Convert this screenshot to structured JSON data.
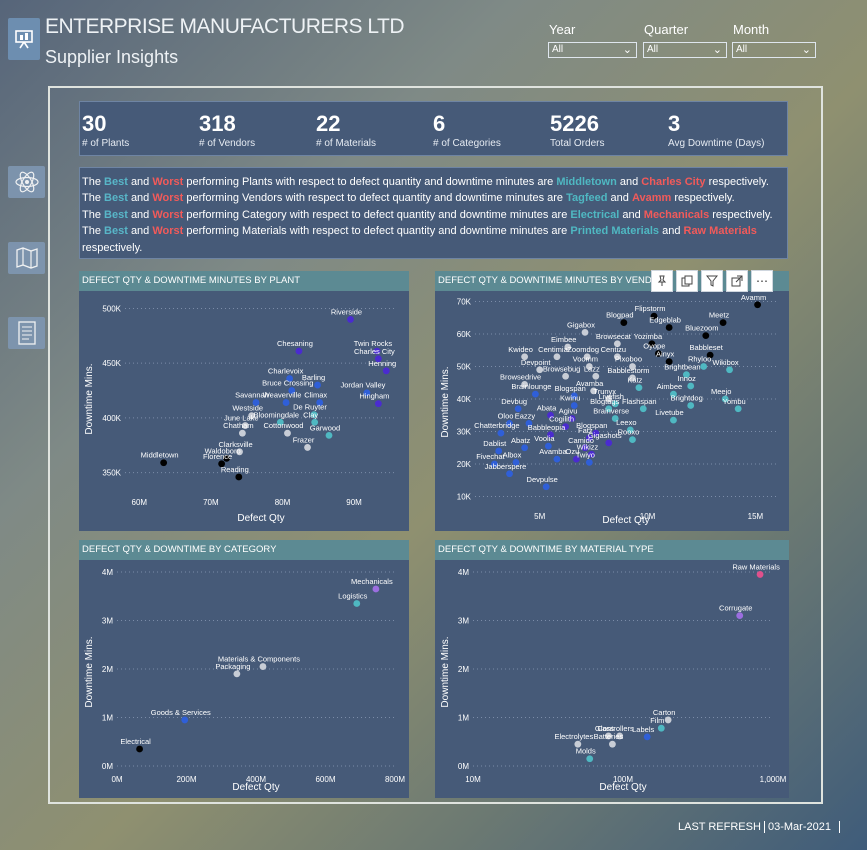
{
  "header": {
    "title": "ENTERPRISE MANUFACTURERS LTD",
    "subtitle": "Supplier Insights"
  },
  "filters": [
    {
      "label": "Year",
      "value": "All"
    },
    {
      "label": "Quarter",
      "value": "All"
    },
    {
      "label": "Month",
      "value": "All"
    }
  ],
  "kpis": [
    {
      "value": "30",
      "label": "# of Plants"
    },
    {
      "value": "318",
      "label": "# of Vendors"
    },
    {
      "value": "22",
      "label": "# of Materials"
    },
    {
      "value": "6",
      "label": "# of Categories"
    },
    {
      "value": "5226",
      "label": "Total Orders"
    },
    {
      "value": "3",
      "label": "Avg Downtime (Days)"
    }
  ],
  "insights": {
    "the": "The",
    "best": "Best",
    "and": "and",
    "worst": "Worst",
    "are": "are",
    "respectively": "respectively.",
    "lines": [
      {
        "pre": "performing Plants with respect to defect quantity and downtime minutes are",
        "best": "Middletown",
        "worst": "Charles City"
      },
      {
        "pre": "performing Vendors with respect to defect quantity and downtime minutes are",
        "best": "Tagfeed",
        "worst": "Avamm"
      },
      {
        "pre": "performing Category with respect to defect quantity and downtime minutes are",
        "best": "Electrical",
        "worst": "Mechanicals"
      },
      {
        "pre": "performing Materials with respect to defect quantity and downtime minutes are",
        "best": "Printed Materials",
        "worst": "Raw Materials"
      }
    ]
  },
  "footer": {
    "last_refresh_label": "LAST REFRESH",
    "date": "03-Mar-2021"
  },
  "colors": {
    "panel": "#465a78",
    "header_bar": "#5c8a93",
    "best": "#58b6c8",
    "worst": "#f25a5a"
  },
  "icons": {
    "logo": "presentation-icon",
    "side1": "atom-icon",
    "side2": "map-icon",
    "side3": "document-icon"
  },
  "chart_data": [
    {
      "type": "scatter",
      "title": "DEFECT QTY & DOWNTIME MINUTES BY PLANT",
      "xlabel": "Defect Qty",
      "ylabel": "Downtime Mins.",
      "xlim": [
        58,
        96
      ],
      "ylim": [
        335,
        505
      ],
      "xticks": [
        {
          "v": 60,
          "t": "60M"
        },
        {
          "v": 70,
          "t": "70M"
        },
        {
          "v": 80,
          "t": "80M"
        },
        {
          "v": 90,
          "t": "90M"
        }
      ],
      "yticks": [
        {
          "v": 350,
          "t": "350K"
        },
        {
          "v": 400,
          "t": "400K"
        },
        {
          "v": 450,
          "t": "450K"
        },
        {
          "v": 500,
          "t": "500K"
        }
      ],
      "points": [
        {
          "label": "Riverside",
          "x": 89.5,
          "y": 490,
          "c": "#4a2bd0"
        },
        {
          "label": "Twin Rocks",
          "x": 93.2,
          "y": 461,
          "c": "#4a2bd0"
        },
        {
          "label": "Chesaning",
          "x": 82.3,
          "y": 461,
          "c": "#4a2bd0"
        },
        {
          "label": "Charles City",
          "x": 93.4,
          "y": 454,
          "c": "#4a2bd0"
        },
        {
          "label": "Henning",
          "x": 94.5,
          "y": 443,
          "c": "#4a2bd0"
        },
        {
          "label": "Charlevoix",
          "x": 81,
          "y": 436,
          "c": "#2f5fd8"
        },
        {
          "label": "Barling",
          "x": 84.9,
          "y": 430,
          "c": "#2f5fd8"
        },
        {
          "label": "Bruce Crossing",
          "x": 81.3,
          "y": 425,
          "c": "#2f5fd8"
        },
        {
          "label": "Jordan Valley",
          "x": 91.8,
          "y": 423,
          "c": "#2f5fd8"
        },
        {
          "label": "Savannah",
          "x": 76.3,
          "y": 414,
          "c": "#2f5fd8"
        },
        {
          "label": "Weaverville",
          "x": 80.5,
          "y": 414,
          "c": "#2f5fd8"
        },
        {
          "label": "Climax",
          "x": 85.2,
          "y": 414,
          "c": "#2f5fd8"
        },
        {
          "label": "Hingham",
          "x": 93.4,
          "y": 413,
          "c": "#4a2bd0"
        },
        {
          "label": "De Ruyter",
          "x": 84.4,
          "y": 403,
          "c": "#4fb8c2"
        },
        {
          "label": "Westside",
          "x": 75.7,
          "y": 402,
          "c": "#c8cdd6"
        },
        {
          "label": "Bloomingdale",
          "x": 79.7,
          "y": 396,
          "c": "#4fb8c2"
        },
        {
          "label": "Clay",
          "x": 84.5,
          "y": 396,
          "c": "#4fb8c2"
        },
        {
          "label": "June Lake",
          "x": 74.8,
          "y": 393,
          "c": "#c8cdd6"
        },
        {
          "label": "Chatham",
          "x": 74.4,
          "y": 386,
          "c": "#c8cdd6"
        },
        {
          "label": "Cottonwood",
          "x": 80.7,
          "y": 386,
          "c": "#c8cdd6"
        },
        {
          "label": "Garwood",
          "x": 86.5,
          "y": 384,
          "c": "#4fb8c2"
        },
        {
          "label": "Frazer",
          "x": 83.5,
          "y": 373,
          "c": "#c8cdd6"
        },
        {
          "label": "Clarksville",
          "x": 74,
          "y": 369,
          "c": "#c8cdd6"
        },
        {
          "label": "Waldoboro",
          "x": 72.2,
          "y": 363,
          "c": "#000000"
        },
        {
          "label": "Middletown",
          "x": 63.4,
          "y": 359,
          "c": "#000000"
        },
        {
          "label": "Florence",
          "x": 71.5,
          "y": 358,
          "c": "#000000"
        },
        {
          "label": "Reading",
          "x": 73.9,
          "y": 346,
          "c": "#000000"
        }
      ]
    },
    {
      "type": "scatter",
      "title": "DEFECT QTY & DOWNTIME MINUTES BY VENDOR",
      "xlabel": "Defect Qty",
      "ylabel": "Downtime Mins.",
      "xlim": [
        2,
        16
      ],
      "ylim": [
        8,
        72
      ],
      "xticks": [
        {
          "v": 5,
          "t": "5M"
        },
        {
          "v": 10,
          "t": "10M"
        },
        {
          "v": 15,
          "t": "15M"
        }
      ],
      "yticks": [
        {
          "v": 10,
          "t": "10K"
        },
        {
          "v": 20,
          "t": "20K"
        },
        {
          "v": 30,
          "t": "30K"
        },
        {
          "v": 40,
          "t": "40K"
        },
        {
          "v": 50,
          "t": "50K"
        },
        {
          "v": 60,
          "t": "60K"
        },
        {
          "v": 70,
          "t": "70K"
        }
      ],
      "points": [
        {
          "label": "Avamm",
          "x": 15.1,
          "y": 69,
          "c": "#000000"
        },
        {
          "label": "Flipstorm",
          "x": 10.3,
          "y": 65.5,
          "c": "#000000"
        },
        {
          "label": "Blogpad",
          "x": 8.9,
          "y": 63.5,
          "c": "#000000"
        },
        {
          "label": "Meetz",
          "x": 13.5,
          "y": 63.5,
          "c": "#000000"
        },
        {
          "label": "Gigabox",
          "x": 7.1,
          "y": 60.5,
          "c": "#c8cdd6"
        },
        {
          "label": "Edgeblab",
          "x": 11,
          "y": 62,
          "c": "#000000"
        },
        {
          "label": "Bluezoom",
          "x": 12.7,
          "y": 59.5,
          "c": "#000000"
        },
        {
          "label": "Browsecat",
          "x": 8.6,
          "y": 57,
          "c": "#c8cdd6"
        },
        {
          "label": "Eimbee",
          "x": 6.3,
          "y": 56,
          "c": "#c8cdd6"
        },
        {
          "label": "Yozimba",
          "x": 10.2,
          "y": 57,
          "c": "#000000"
        },
        {
          "label": "Kwideo",
          "x": 4.3,
          "y": 53,
          "c": "#c8cdd6"
        },
        {
          "label": "Centimia",
          "x": 5.8,
          "y": 53,
          "c": "#c8cdd6"
        },
        {
          "label": "Zoomdog",
          "x": 7.2,
          "y": 53,
          "c": "#c8cdd6"
        },
        {
          "label": "Centizu",
          "x": 8.6,
          "y": 53,
          "c": "#c8cdd6"
        },
        {
          "label": "Oyope",
          "x": 10.5,
          "y": 54,
          "c": "#000000"
        },
        {
          "label": "Babbleset",
          "x": 12.9,
          "y": 53.5,
          "c": "#000000"
        },
        {
          "label": "Ainyx",
          "x": 11,
          "y": 51.5,
          "c": "#000000"
        },
        {
          "label": "Devpoint",
          "x": 5,
          "y": 49,
          "c": "#c8cdd6"
        },
        {
          "label": "Voomm",
          "x": 7.3,
          "y": 50,
          "c": "#c8cdd6"
        },
        {
          "label": "Pixoboo",
          "x": 9.3,
          "y": 50,
          "c": "#c8cdd6"
        },
        {
          "label": "Rhyloo",
          "x": 12.6,
          "y": 50,
          "c": "#4fb8c2"
        },
        {
          "label": "Brightbean",
          "x": 11.8,
          "y": 47.5,
          "c": "#4fb8c2"
        },
        {
          "label": "Wikibox",
          "x": 13.8,
          "y": 49,
          "c": "#4fb8c2"
        },
        {
          "label": "Browsebug",
          "x": 6.2,
          "y": 47,
          "c": "#c8cdd6"
        },
        {
          "label": "Lazz",
          "x": 7.6,
          "y": 47,
          "c": "#c8cdd6"
        },
        {
          "label": "Babblestorm",
          "x": 9.3,
          "y": 46.5,
          "c": "#c8cdd6"
        },
        {
          "label": "Browsedrive",
          "x": 4.3,
          "y": 44.5,
          "c": "#c8cdd6"
        },
        {
          "label": "Avamba",
          "x": 7.5,
          "y": 42.5,
          "c": "#c8cdd6"
        },
        {
          "label": "Katz",
          "x": 9.6,
          "y": 43.5,
          "c": "#4fb8c2"
        },
        {
          "label": "Innoz",
          "x": 12,
          "y": 44,
          "c": "#4fb8c2"
        },
        {
          "label": "Brainlounge",
          "x": 4.8,
          "y": 41.5,
          "c": "#2f5fd8"
        },
        {
          "label": "Blogspan",
          "x": 6.6,
          "y": 41,
          "c": "#2f5fd8"
        },
        {
          "label": "Trunyx",
          "x": 8.2,
          "y": 40,
          "c": "#c8cdd6"
        },
        {
          "label": "Aimbee",
          "x": 11.2,
          "y": 41.5,
          "c": "#4fb8c2"
        },
        {
          "label": "Meejo",
          "x": 13.6,
          "y": 40,
          "c": "#4fb8c2"
        },
        {
          "label": "Livefish",
          "x": 8.5,
          "y": 38.5,
          "c": "#4fb8c2"
        },
        {
          "label": "Devbug",
          "x": 4,
          "y": 37,
          "c": "#2f5fd8"
        },
        {
          "label": "Kwinu",
          "x": 6.6,
          "y": 38,
          "c": "#2f5fd8"
        },
        {
          "label": "Blogtags",
          "x": 8.2,
          "y": 37,
          "c": "#4fb8c2"
        },
        {
          "label": "Flashspan",
          "x": 9.8,
          "y": 37,
          "c": "#4fb8c2"
        },
        {
          "label": "Brightdog",
          "x": 12,
          "y": 38,
          "c": "#4fb8c2"
        },
        {
          "label": "Yombu",
          "x": 14.2,
          "y": 37,
          "c": "#4fb8c2"
        },
        {
          "label": "Abata",
          "x": 5.5,
          "y": 35,
          "c": "#4a2bd0"
        },
        {
          "label": "Agivu",
          "x": 6.5,
          "y": 34,
          "c": "#4a2bd0"
        },
        {
          "label": "Brainverse",
          "x": 8.5,
          "y": 34,
          "c": "#4fb8c2"
        },
        {
          "label": "Livetube",
          "x": 11.2,
          "y": 33.5,
          "c": "#4fb8c2"
        },
        {
          "label": "Oloo",
          "x": 3.6,
          "y": 32.5,
          "c": "#2f5fd8"
        },
        {
          "label": "Eazzy",
          "x": 4.5,
          "y": 32.5,
          "c": "#2f5fd8"
        },
        {
          "label": "Cogilith",
          "x": 6.2,
          "y": 31.5,
          "c": "#4a2bd0"
        },
        {
          "label": "Leexo",
          "x": 9.2,
          "y": 30.5,
          "c": "#4fb8c2"
        },
        {
          "label": "Chatterbridge",
          "x": 3.2,
          "y": 29.5,
          "c": "#2f5fd8"
        },
        {
          "label": "Babbleopia",
          "x": 5.5,
          "y": 29,
          "c": "#4a2bd0"
        },
        {
          "label": "Blogspan",
          "x": 7.6,
          "y": 29.5,
          "c": "#4a2bd0"
        },
        {
          "label": "Fatz",
          "x": 7.3,
          "y": 28,
          "c": "#4a2bd0"
        },
        {
          "label": "Rooxo",
          "x": 9.3,
          "y": 27.5,
          "c": "#4fb8c2"
        },
        {
          "label": "Gigashots",
          "x": 8.2,
          "y": 26.5,
          "c": "#4a2bd0"
        },
        {
          "label": "Abatz",
          "x": 4.3,
          "y": 25,
          "c": "#2f5fd8"
        },
        {
          "label": "Voolia",
          "x": 5.4,
          "y": 25.5,
          "c": "#2f5fd8"
        },
        {
          "label": "Camido",
          "x": 7.1,
          "y": 25,
          "c": "#4a2bd0"
        },
        {
          "label": "Dablist",
          "x": 3.1,
          "y": 24,
          "c": "#2f5fd8"
        },
        {
          "label": "Wikizz",
          "x": 7.4,
          "y": 23,
          "c": "#4a2bd0"
        },
        {
          "label": "Albox",
          "x": 3.9,
          "y": 20.5,
          "c": "#2f5fd8"
        },
        {
          "label": "Avamba",
          "x": 5.8,
          "y": 21.5,
          "c": "#2f5fd8"
        },
        {
          "label": "Ozu",
          "x": 6.7,
          "y": 21.5,
          "c": "#4a2bd0"
        },
        {
          "label": "Twiyo",
          "x": 7.3,
          "y": 20.5,
          "c": "#2f5fd8"
        },
        {
          "label": "Fivechat",
          "x": 2.9,
          "y": 20,
          "c": "#2f5fd8"
        },
        {
          "label": "Jabberspere",
          "x": 3.6,
          "y": 17,
          "c": "#2f5fd8"
        },
        {
          "label": "Devpulse",
          "x": 5.3,
          "y": 13,
          "c": "#2f5fd8"
        }
      ]
    },
    {
      "type": "scatter",
      "title": "DEFECT QTY & DOWNTIME BY CATEGORY",
      "xlabel": "Defect Qty",
      "ylabel": "Downtime Mins.",
      "xlim": [
        0,
        800
      ],
      "ylim": [
        0,
        4
      ],
      "xticks": [
        {
          "v": 0,
          "t": "0M"
        },
        {
          "v": 200,
          "t": "200M"
        },
        {
          "v": 400,
          "t": "400M"
        },
        {
          "v": 600,
          "t": "600M"
        },
        {
          "v": 800,
          "t": "800M"
        }
      ],
      "yticks": [
        {
          "v": 0,
          "t": "0M"
        },
        {
          "v": 1,
          "t": "1M"
        },
        {
          "v": 2,
          "t": "2M"
        },
        {
          "v": 3,
          "t": "3M"
        },
        {
          "v": 4,
          "t": "4M"
        }
      ],
      "points": [
        {
          "label": "Mechanicals",
          "x": 745,
          "y": 3.65,
          "c": "#9b6ee0"
        },
        {
          "label": "Logistics",
          "x": 690,
          "y": 3.35,
          "c": "#4fb8c2"
        },
        {
          "label": "Materials & Components",
          "x": 420,
          "y": 2.05,
          "c": "#c8cdd6"
        },
        {
          "label": "Packaging",
          "x": 345,
          "y": 1.9,
          "c": "#c8cdd6"
        },
        {
          "label": "Goods & Services",
          "x": 195,
          "y": 0.95,
          "c": "#2f5fd8"
        },
        {
          "label": "Electrical",
          "x": 65,
          "y": 0.35,
          "c": "#000000"
        }
      ]
    },
    {
      "type": "scatter",
      "title": "DEFECT QTY & DOWNTIME BY MATERIAL TYPE",
      "xlabel": "Defect Qty",
      "ylabel": "Downtime Mins.",
      "xscale": "log",
      "xlim": [
        10,
        1000
      ],
      "ylim": [
        0,
        4
      ],
      "xticks": [
        {
          "v": 10,
          "t": "10M"
        },
        {
          "v": 100,
          "t": "100M"
        },
        {
          "v": 1000,
          "t": "1,000M"
        }
      ],
      "yticks": [
        {
          "v": 0,
          "t": "0M"
        },
        {
          "v": 1,
          "t": "1M"
        },
        {
          "v": 2,
          "t": "2M"
        },
        {
          "v": 3,
          "t": "3M"
        },
        {
          "v": 4,
          "t": "4M"
        }
      ],
      "points": [
        {
          "label": "Raw Materials",
          "x": 820,
          "y": 3.95,
          "c": "#e0508c"
        },
        {
          "label": "Corrugate",
          "x": 600,
          "y": 3.1,
          "c": "#9b6ee0"
        },
        {
          "label": "Carton",
          "x": 200,
          "y": 0.95,
          "c": "#c8cdd6"
        },
        {
          "label": "Film",
          "x": 180,
          "y": 0.78,
          "c": "#4fb8c2"
        },
        {
          "label": "Glass",
          "x": 80,
          "y": 0.62,
          "c": "#c8cdd6"
        },
        {
          "label": "Controllers",
          "x": 95,
          "y": 0.62,
          "c": "#c8cdd6"
        },
        {
          "label": "Labels",
          "x": 145,
          "y": 0.6,
          "c": "#2f5fd8"
        },
        {
          "label": "Electrolytes",
          "x": 50,
          "y": 0.45,
          "c": "#c8cdd6"
        },
        {
          "label": "Batteries",
          "x": 85,
          "y": 0.45,
          "c": "#c8cdd6"
        },
        {
          "label": "Molds",
          "x": 60,
          "y": 0.15,
          "c": "#4fb8c2"
        }
      ]
    }
  ]
}
